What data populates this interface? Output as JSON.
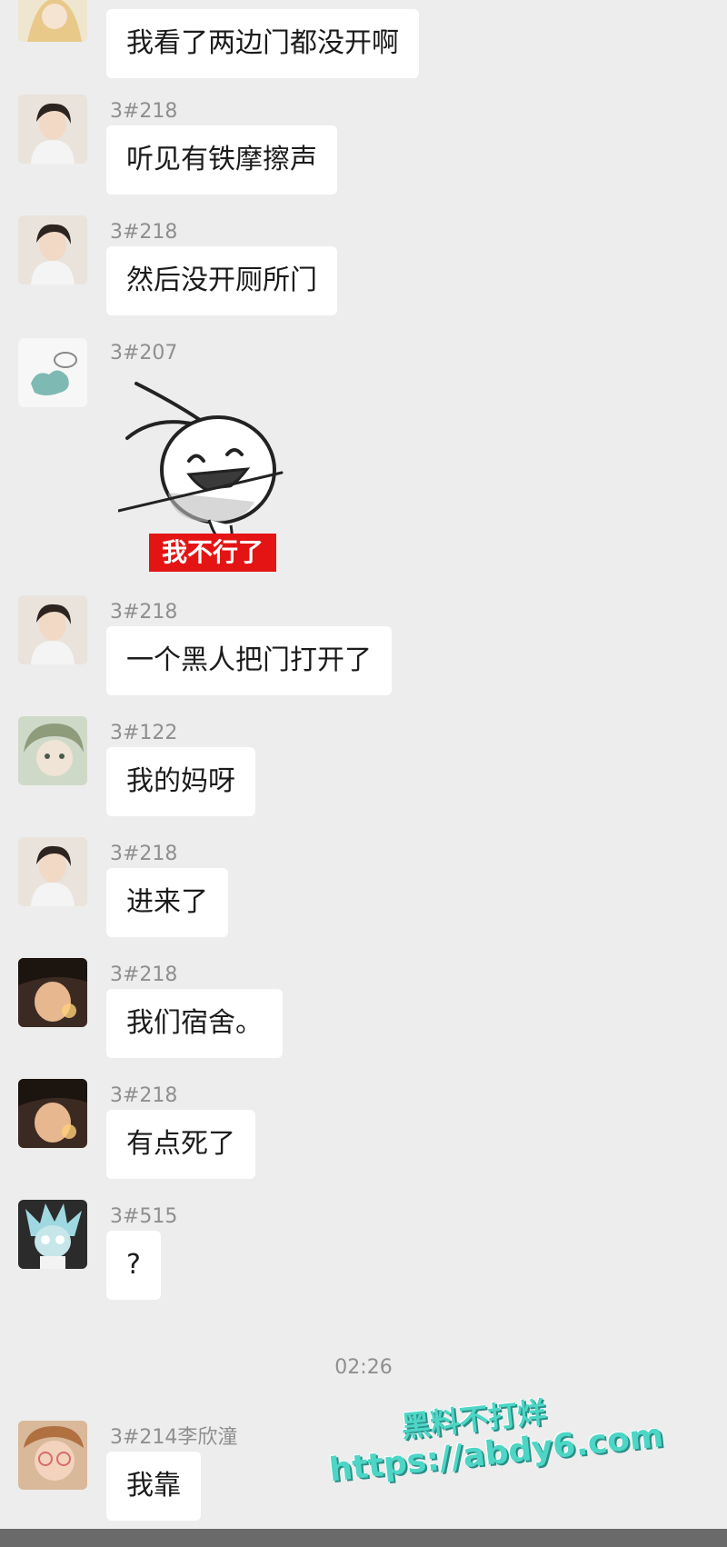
{
  "messages": [
    {
      "sender": "",
      "text": "我看了两边门都没开啊"
    },
    {
      "sender": "3#218",
      "text": "听见有铁摩擦声"
    },
    {
      "sender": "3#218",
      "text": "然后没开厕所门"
    },
    {
      "sender": "3#207",
      "sticker_caption": "我不行了"
    },
    {
      "sender": "3#218",
      "text": "一个黑人把门打开了"
    },
    {
      "sender": "3#122",
      "text": "我的妈呀"
    },
    {
      "sender": "3#218",
      "text": "进来了"
    },
    {
      "sender": "3#218",
      "text": "我们宿舍。"
    },
    {
      "sender": "3#218",
      "text": "有点死了"
    },
    {
      "sender": "3#515",
      "text": "?"
    },
    {
      "sender": "3#214李欣潼",
      "text": "我靠"
    }
  ],
  "timestamp": "02:26",
  "watermark": {
    "line1": "黑料不打烊",
    "line2": "https://abdy6.com"
  }
}
